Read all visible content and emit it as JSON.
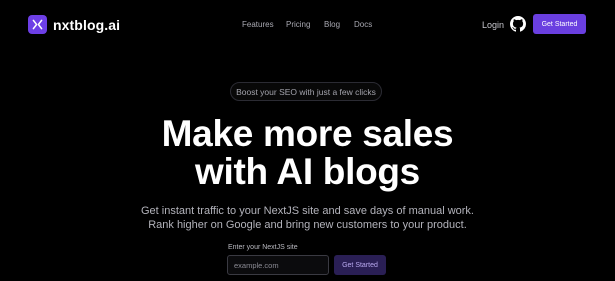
{
  "brand": {
    "name": "nxtblog.ai",
    "logo_icon": "close-x-icon",
    "logo_color": "#6d3fe6"
  },
  "nav": {
    "items": [
      "Features",
      "Pricing",
      "Blog",
      "Docs"
    ]
  },
  "header": {
    "login_label": "Login",
    "github_icon": "github-icon",
    "cta_label": "Get Started",
    "cta_color": "#6a3fe0"
  },
  "hero": {
    "badge": "Boost your SEO with just a few clicks",
    "headline_line1": "Make more sales",
    "headline_line2": "with AI blogs",
    "sub_line1": "Get instant traffic to your NextJS site and save days of manual work.",
    "sub_line2": "Rank higher on Google and bring new customers to your product.",
    "input_label": "Enter your NextJS site",
    "input_placeholder": "example.com",
    "input_value": "",
    "button_label": "Get Started"
  }
}
